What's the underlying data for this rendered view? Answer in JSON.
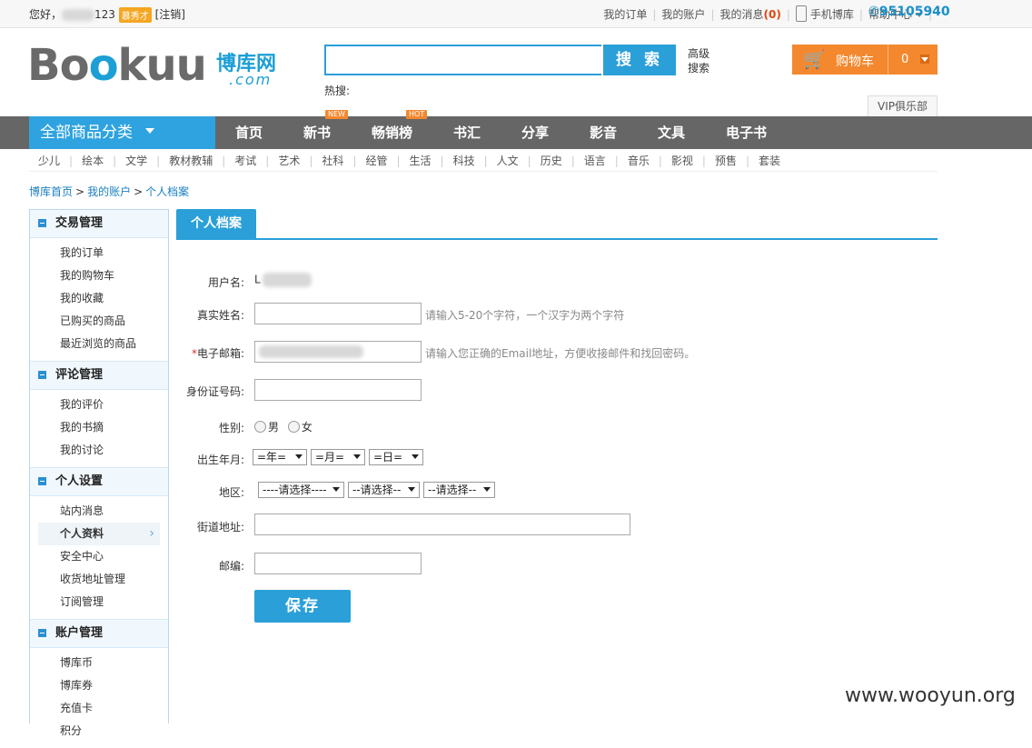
{
  "topbar": {
    "greeting": "您好，",
    "username_suffix": "123",
    "badge": "慕秀才",
    "logout": "[注销]",
    "links": {
      "orders": "我的订单",
      "account": "我的账户",
      "messages": "我的消息",
      "message_count": "(0)",
      "mobile": "手机博库",
      "help": "帮助中心"
    },
    "hotline": "95105940"
  },
  "logo": {
    "main_pre": "Bo",
    "main_blue": "o",
    "main_post": "kuu",
    "cn": "博库网",
    "com": ".com"
  },
  "search": {
    "placeholder": "",
    "button": "搜 索",
    "advanced": "高级搜索",
    "hot": "热搜:"
  },
  "cart": {
    "label": "购物车",
    "count": "0"
  },
  "vip": "VIP俱乐部",
  "nav": {
    "all_categories": "全部商品分类",
    "items": [
      "首页",
      "新书",
      "畅销榜",
      "书汇",
      "分享",
      "影音",
      "文具",
      "电子书"
    ],
    "tags": {
      "new": "NEW",
      "hot": "HOT"
    }
  },
  "subnav": [
    "少儿",
    "绘本",
    "文学",
    "教材教辅",
    "考试",
    "艺术",
    "社科",
    "经管",
    "生活",
    "科技",
    "人文",
    "历史",
    "语言",
    "音乐",
    "影视",
    "预售",
    "套装"
  ],
  "breadcrumb": [
    "博库首页",
    "我的账户",
    "个人档案"
  ],
  "sidebar": {
    "sections": [
      {
        "title": "交易管理",
        "items": [
          "我的订单",
          "我的购物车",
          "我的收藏",
          "已购买的商品",
          "最近浏览的商品"
        ]
      },
      {
        "title": "评论管理",
        "items": [
          "我的评价",
          "我的书摘",
          "我的讨论"
        ]
      },
      {
        "title": "个人设置",
        "items": [
          "站内消息",
          "个人资料",
          "安全中心",
          "收货地址管理",
          "订阅管理"
        ]
      },
      {
        "title": "账户管理",
        "items": [
          "博库币",
          "博库券",
          "充值卡",
          "积分"
        ]
      }
    ],
    "active": "个人资料"
  },
  "main": {
    "tab": "个人档案",
    "fields": {
      "username": {
        "label": "用户名:",
        "value_prefix": "L"
      },
      "realname": {
        "label": "真实姓名:",
        "value": "",
        "hint": "请输入5-20个字符，一个汉字为两个字符"
      },
      "email": {
        "required": "*",
        "label": "电子邮箱:",
        "hint": "请输入您正确的Email地址，方便收接邮件和找回密码。"
      },
      "idcard": {
        "label": "身份证号码:",
        "value": ""
      },
      "gender": {
        "label": "性别:",
        "male": "男",
        "female": "女"
      },
      "birthday": {
        "label": "出生年月:",
        "year": "=年=",
        "month": "=月=",
        "day": "=日="
      },
      "region": {
        "label": "地区:",
        "province": "----请选择----",
        "city": "--请选择--",
        "district": "--请选择--"
      },
      "street": {
        "label": "街道地址:",
        "value": ""
      },
      "zip": {
        "label": "邮编:",
        "value": ""
      }
    },
    "save": "保存"
  },
  "watermark": "www.wooyun.org"
}
